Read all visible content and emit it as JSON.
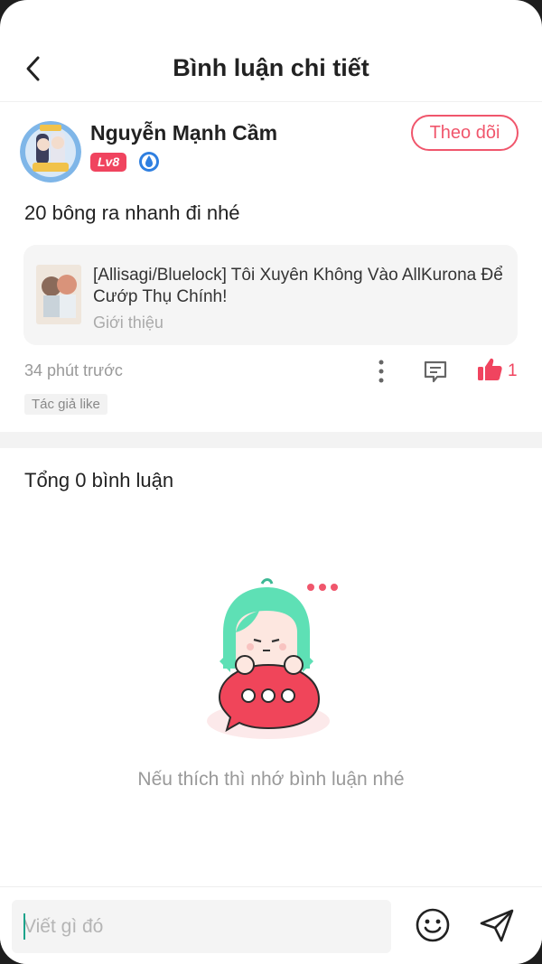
{
  "header": {
    "title": "Bình luận chi tiết"
  },
  "post": {
    "username": "Nguyễn Mạnh Cầm",
    "level": "Lv8",
    "follow_label": "Theo dõi",
    "text": "20 bông ra nhanh đi nhé",
    "book": {
      "title": "[Allisagi/Bluelock] Tôi Xuyên Không Vào AllKurona Để Cướp Thụ Chính!",
      "subtitle": "Giới thiệu"
    },
    "time": "34 phút trước",
    "like_count": "1",
    "author_tag": "Tác giả like"
  },
  "comments": {
    "total_label": "Tổng 0 bình luận",
    "empty_text": "Nếu thích thì nhớ bình luận nhé"
  },
  "composer": {
    "placeholder": "Viết gì đó"
  },
  "colors": {
    "accent": "#f0445f",
    "mascot_hair": "#5ee0b5",
    "bubble": "#f0455a"
  },
  "icons": [
    "back-icon",
    "vip-drop-icon",
    "more-icon",
    "comment-icon",
    "like-icon",
    "emoji-icon",
    "send-icon"
  ]
}
